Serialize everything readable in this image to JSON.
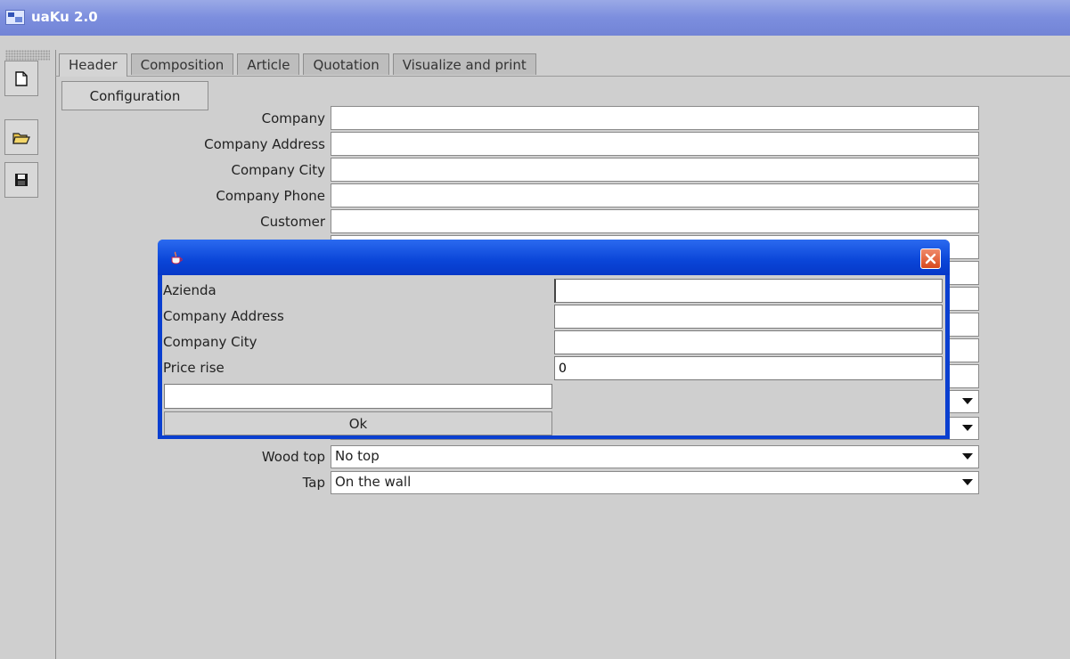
{
  "window": {
    "title": "uaKu 2.0"
  },
  "toolbar": [
    {
      "name": "new-document-icon"
    },
    {
      "name": "open-folder-icon"
    },
    {
      "name": "save-disk-icon"
    }
  ],
  "tabs": [
    {
      "label": "Header",
      "active": true
    },
    {
      "label": "Composition",
      "active": false
    },
    {
      "label": "Article",
      "active": false
    },
    {
      "label": "Quotation",
      "active": false
    },
    {
      "label": "Visualize and print",
      "active": false
    }
  ],
  "configuration_button": "Configuration",
  "form": {
    "company": {
      "label": "Company",
      "value": ""
    },
    "company_address": {
      "label": "Company Address",
      "value": ""
    },
    "company_city": {
      "label": "Company City",
      "value": ""
    },
    "company_phone": {
      "label": "Company Phone",
      "value": ""
    },
    "customer": {
      "label": "Customer",
      "value": ""
    },
    "wood_top": {
      "label": "Wood top",
      "value": "No top"
    },
    "tap": {
      "label": "Tap",
      "value": "On the wall"
    }
  },
  "dialog": {
    "rows": [
      {
        "label": "Azienda",
        "value": ""
      },
      {
        "label": "Company Address",
        "value": ""
      },
      {
        "label": "Company City",
        "value": ""
      },
      {
        "label": "Price rise",
        "value": "0"
      }
    ],
    "extra_field_value": "",
    "ok_label": "Ok"
  },
  "colors": {
    "titlebar": "#7c8ede",
    "dialog_titlebar": "#0a45d8",
    "close_button": "#d8481e",
    "background": "#cfcfcf"
  }
}
